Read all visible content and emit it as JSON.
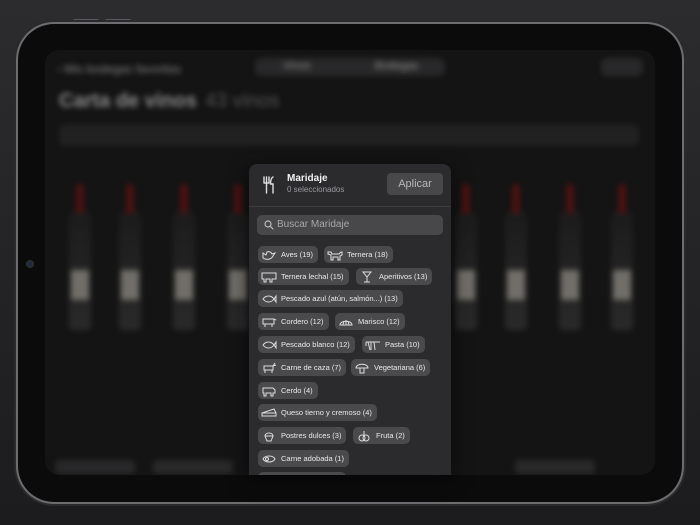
{
  "screen_background": {
    "back_link": "Mis bodegas favoritas",
    "segments": [
      "Vinos",
      "Bodegas"
    ],
    "title": "Carta de vinos",
    "count": "43 vinos"
  },
  "panel": {
    "title": "Maridaje",
    "subtitle": "0 seleccionados",
    "apply_label": "Aplicar",
    "search_placeholder": "Buscar Maridaje",
    "tags": [
      {
        "label": "Aves (19)",
        "icon": "bird-icon"
      },
      {
        "label": "Ternera (18)",
        "icon": "cow-icon"
      },
      {
        "label": "Ternera lechal (15)",
        "icon": "calf-icon"
      },
      {
        "label": "Aperitivos (13)",
        "icon": "cocktail-icon"
      },
      {
        "label": "Pescado azul (atún, salmón...) (13)",
        "icon": "fish-icon"
      },
      {
        "label": "Cordero (12)",
        "icon": "lamb-icon"
      },
      {
        "label": "Marisco (12)",
        "icon": "shell-icon"
      },
      {
        "label": "Pescado blanco (12)",
        "icon": "fish-icon"
      },
      {
        "label": "Pasta (10)",
        "icon": "pasta-icon"
      },
      {
        "label": "Carne de caza (7)",
        "icon": "deer-icon"
      },
      {
        "label": "Vegetariana (6)",
        "icon": "mushroom-icon"
      },
      {
        "label": "Cerdo (4)",
        "icon": "pig-icon"
      },
      {
        "label": "Queso tierno y cremoso (4)",
        "icon": "cheese-icon"
      },
      {
        "label": "Postres dulces (3)",
        "icon": "dessert-icon"
      },
      {
        "label": "Fruta (2)",
        "icon": "fruit-icon"
      },
      {
        "label": "Carne adobada (1)",
        "icon": "marinated-meat-icon"
      }
    ]
  }
}
